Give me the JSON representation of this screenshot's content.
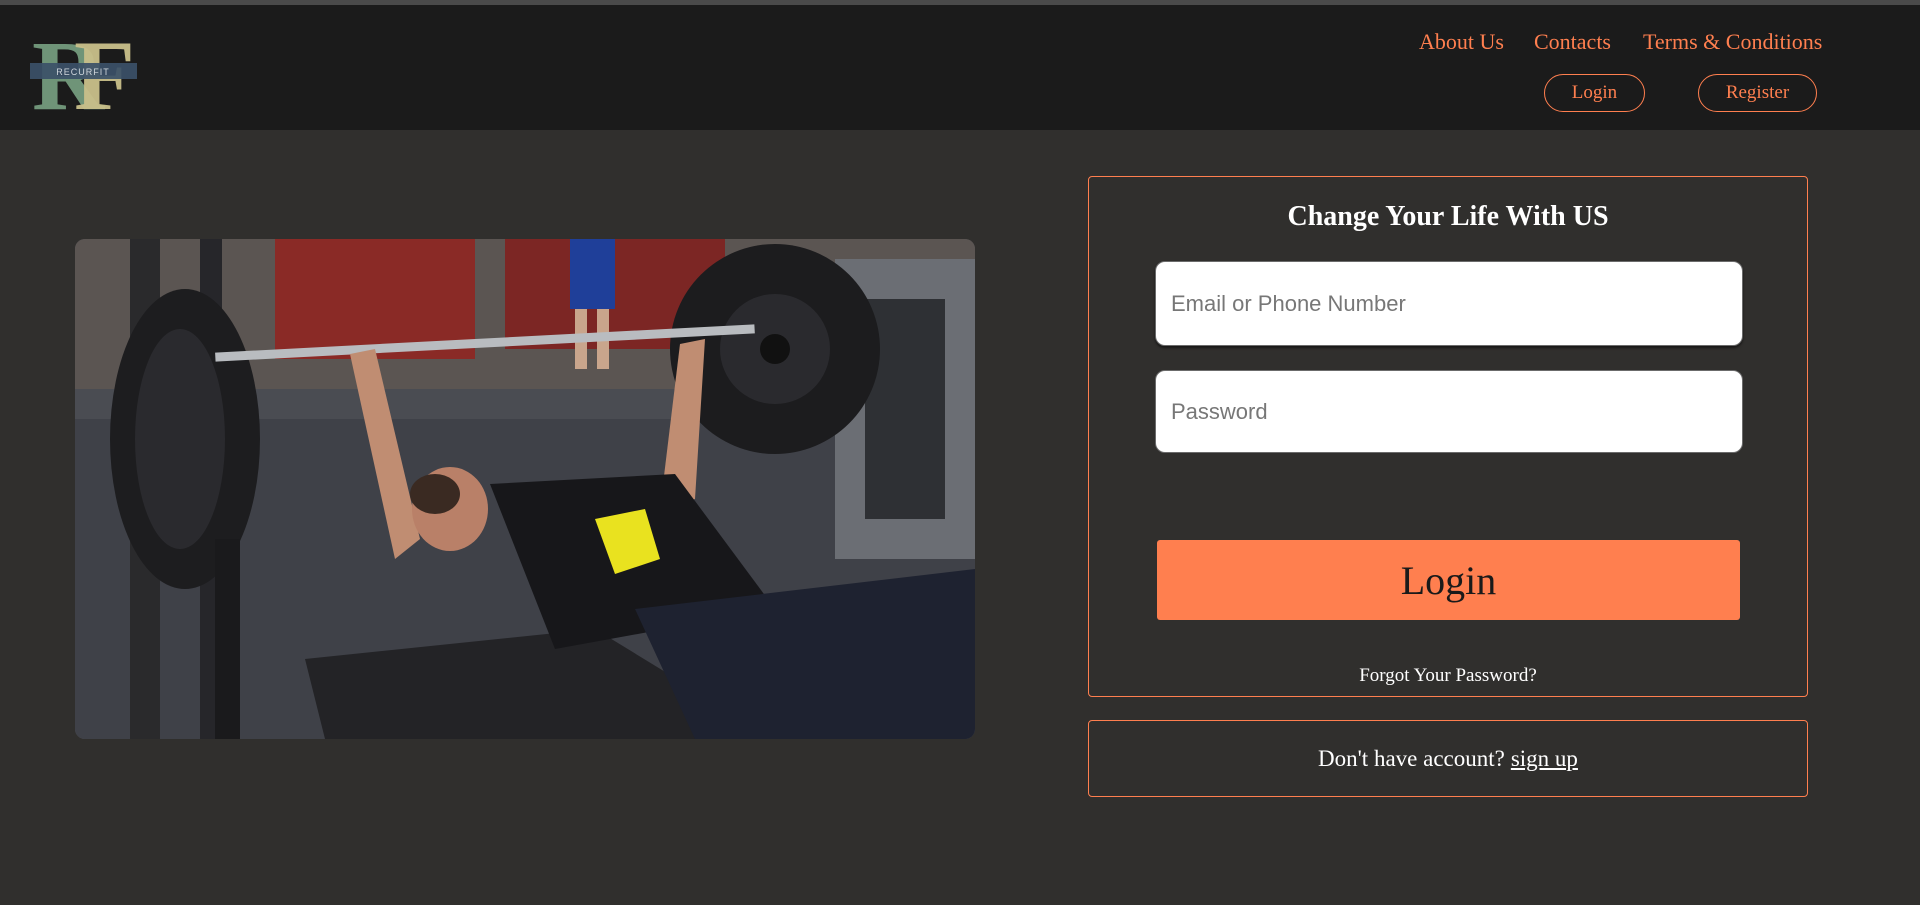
{
  "brand": {
    "logo_letters": "RF",
    "logo_name": "RECURFIT"
  },
  "nav": {
    "about": "About Us",
    "contacts": "Contacts",
    "terms": "Terms & Conditions",
    "login": "Login",
    "register": "Register"
  },
  "hero": {
    "image": "gym-bench-press-photo"
  },
  "login_form": {
    "title": "Change Your Life With US",
    "email_placeholder": "Email or Phone Number",
    "password_placeholder": "Password",
    "submit": "Login",
    "forgot": "Forgot Your Password?"
  },
  "signup": {
    "prompt": "Don't have account?",
    "link": "sign up"
  },
  "colors": {
    "accent": "#ff7f4f",
    "header_bg": "#1b1b1b",
    "page_bg": "#302f2d",
    "logo_green": "#6f9478",
    "logo_gold": "#c9c08a",
    "logo_band": "#3b5068"
  }
}
